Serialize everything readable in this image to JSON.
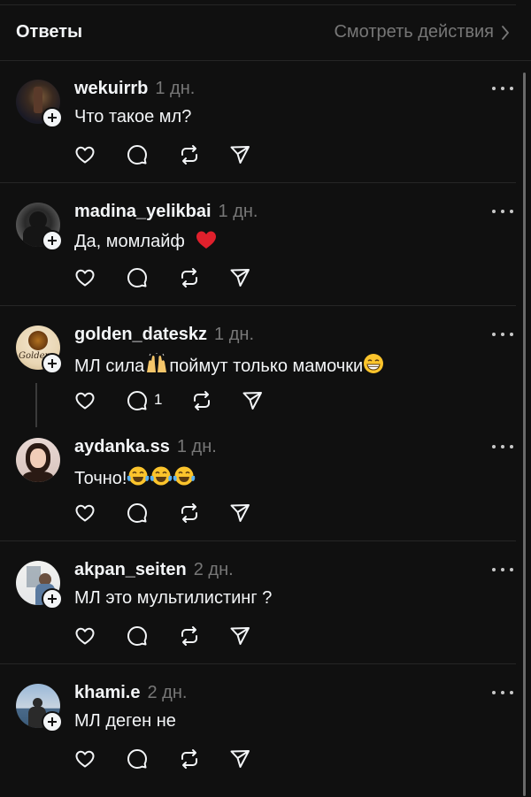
{
  "header": {
    "title": "Ответы",
    "action": "Смотреть действия"
  },
  "posts": [
    {
      "username": "wekuirrb",
      "time": "1 дн.",
      "text": "Что такое мл?"
    },
    {
      "username": "madina_yelikbai",
      "time": "1 дн.",
      "text": "Да, момлайф"
    },
    {
      "username": "golden_dateskz",
      "time": "1 дн.",
      "text_a": "МЛ сила",
      "text_b": "поймут только мамочки",
      "reply_count": "1",
      "avatar_text": "Golden"
    },
    {
      "username": "aydanka.ss",
      "time": "1 дн.",
      "text": "Точно!"
    },
    {
      "username": "akpan_seiten",
      "time": "2 дн.",
      "text": "МЛ это мультилистинг ?"
    },
    {
      "username": "khami.e",
      "time": "2 дн.",
      "text": "МЛ деген не"
    }
  ],
  "icons": [
    "heart-icon",
    "comment-icon",
    "repost-icon",
    "share-icon",
    "more-icon",
    "follow-plus-icon",
    "chevron-right-icon"
  ],
  "colors": {
    "background": "#101010",
    "text": "#f3f5f7",
    "muted": "#777777",
    "divider": "#262626"
  }
}
